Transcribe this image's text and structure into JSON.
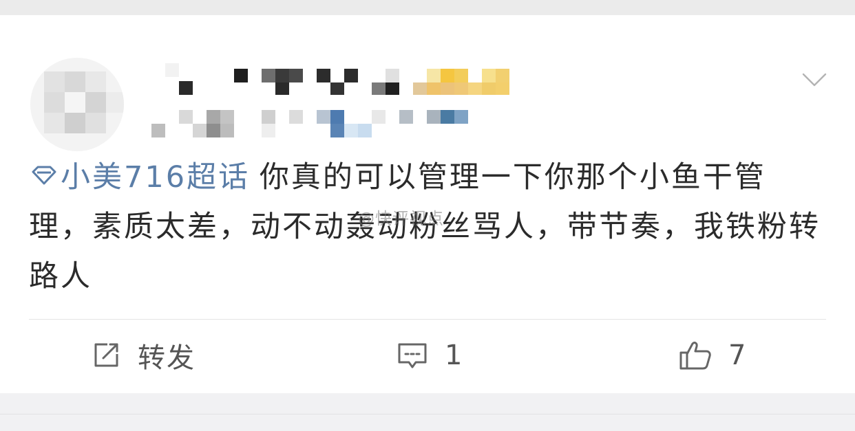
{
  "post": {
    "topic_label": "小美716超话",
    "text": "你真的可以管理一下你那个小鱼干管理，素质太差，动不动轰动粉丝骂人，带节奏，我铁粉转路人"
  },
  "watermark": "@快评视点",
  "actions": {
    "repost_label": "转发",
    "comment_count": "1",
    "like_count": "7"
  },
  "icons": {
    "topic": "diamond-icon",
    "menu": "chevron-down-icon",
    "repost": "share-edit-icon",
    "comment": "comment-icon",
    "like": "thumbs-up-icon"
  },
  "colors": {
    "topic": "#5b7ea8",
    "text": "#2b2b2b",
    "action": "#555555"
  }
}
